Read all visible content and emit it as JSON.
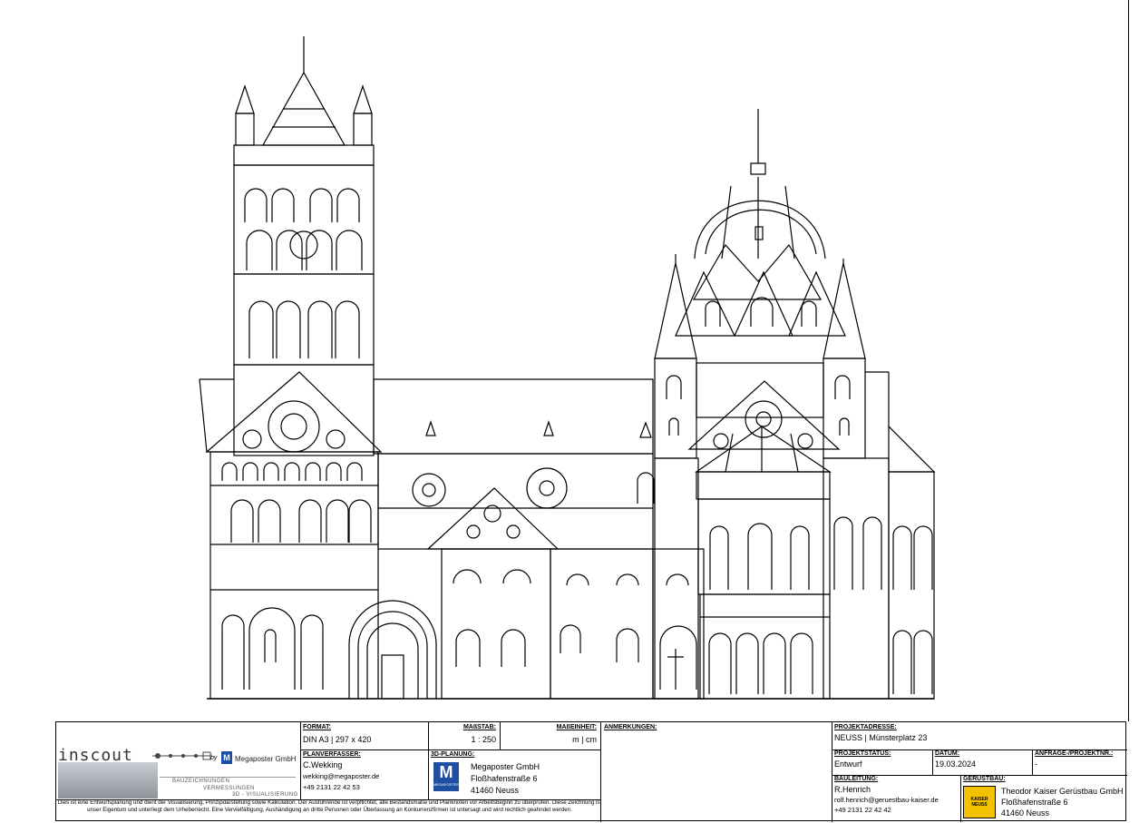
{
  "title_block": {
    "logo": {
      "text": "inscout",
      "by": "by",
      "partner": "Megaposter GmbH",
      "lines": [
        "BAUZEICHNUNGEN",
        "VERMESSUNGEN",
        "3D - VISUALISIERUNG"
      ]
    },
    "format": {
      "label": "FORMAT:",
      "value": "DIN A3 | 297 x 420"
    },
    "scale": {
      "label": "MAßSTAB:",
      "value": "1 : 250"
    },
    "units": {
      "label": "MAßEINHEIT:",
      "value": "m | cm"
    },
    "remarks": {
      "label": "ANMERKUNGEN:",
      "value": ""
    },
    "drafter": {
      "label": "PLANVERFASSER:",
      "name": "C.Wekking",
      "email": "wekking@megaposter.de",
      "phone": "+49 2131 22 42 53"
    },
    "planning": {
      "label": "3D-PLANUNG:",
      "company": "Megaposter GmbH",
      "street": "Floßhafenstraße 6",
      "city": "41460 Neuss"
    },
    "project_address": {
      "label": "PROJEKTADRESSE:",
      "value": "NEUSS | Münsterplatz 23"
    },
    "project_status": {
      "label": "PROJEKTSTATUS:",
      "value": "Entwurf"
    },
    "date": {
      "label": "DATUM:",
      "value": "19.03.2024"
    },
    "request": {
      "label": "ANFRAGE-/PROJEKTNR.:",
      "value": "-"
    },
    "site_manager": {
      "label": "BAULEITUNG:",
      "name": "R.Henrich",
      "email": "rolf.henrich@geruestbau-kaiser.de",
      "phone": "+49 2131 22 42 42"
    },
    "scaffolding": {
      "label": "GERÜSTBAU:",
      "company": "Theodor Kaiser Gerüstbau GmbH",
      "street": "Floßhafenstraße 6",
      "city": "41460 Neuss",
      "logo_text": "KAISER NEUSS"
    },
    "disclaimer": "Dies ist eine Entwurfsplanung und dient der Visualisierung, Prinzipdarstellung sowie Kalkulation. Der Ausführende ist verpflichtet, alle Bestandsmaße und Planknoten vor Arbeitsbeginn zu überprüfen. Diese Zeichnung ist unser Eigentum und unterliegt dem Urheberrecht. Eine Vervielfältigung, Aushändigung an dritte Personen oder Überlassung an Konkurrenzfirmen ist untersagt und wird rechtlich geahndet werden."
  },
  "colors": {
    "line": "#000000",
    "megaposter_blue": "#1f4fa3",
    "kaiser_yellow": "#f3c300"
  }
}
